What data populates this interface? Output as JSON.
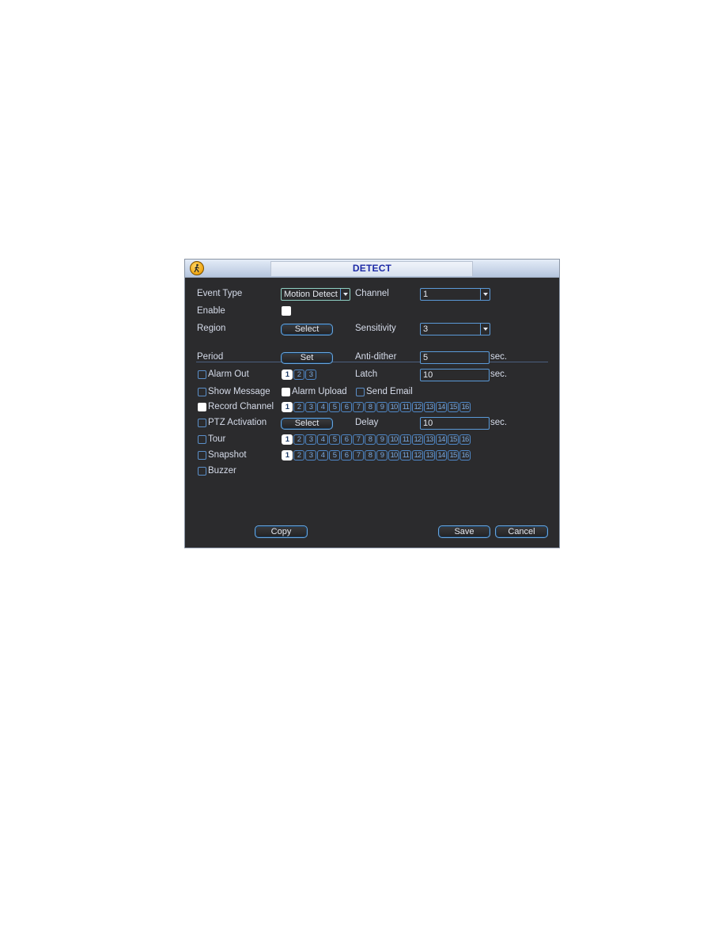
{
  "window": {
    "title": "DETECT",
    "icon": "motion-detect-person-icon"
  },
  "form": {
    "event_type": {
      "label": "Event Type",
      "value": "Motion Detect"
    },
    "channel": {
      "label": "Channel",
      "value": "1"
    },
    "enable": {
      "label": "Enable",
      "checked": true
    },
    "region": {
      "label": "Region",
      "button": "Select"
    },
    "sensitivity": {
      "label": "Sensitivity",
      "value": "3"
    },
    "period": {
      "label": "Period",
      "button": "Set"
    },
    "anti_dither": {
      "label": "Anti-dither",
      "value": "5",
      "unit": "sec."
    },
    "alarm_out": {
      "label": "Alarm Out",
      "checked": false,
      "channels": [
        "1",
        "2",
        "3"
      ],
      "selected": [
        "1"
      ]
    },
    "latch": {
      "label": "Latch",
      "value": "10",
      "unit": "sec."
    },
    "show_message": {
      "label": "Show Message",
      "checked": false
    },
    "alarm_upload": {
      "label": "Alarm Upload",
      "checked": true
    },
    "send_email": {
      "label": "Send Email",
      "checked": false
    },
    "record_channel": {
      "label": "Record Channel",
      "checked": true,
      "channels": [
        "1",
        "2",
        "3",
        "4",
        "5",
        "6",
        "7",
        "8",
        "9",
        "10",
        "11",
        "12",
        "13",
        "14",
        "15",
        "16"
      ],
      "selected": [
        "1"
      ]
    },
    "ptz_activation": {
      "label": "PTZ Activation",
      "checked": false,
      "button": "Select"
    },
    "delay": {
      "label": "Delay",
      "value": "10",
      "unit": "sec."
    },
    "tour": {
      "label": "Tour",
      "checked": false,
      "channels": [
        "1",
        "2",
        "3",
        "4",
        "5",
        "6",
        "7",
        "8",
        "9",
        "10",
        "11",
        "12",
        "13",
        "14",
        "15",
        "16"
      ],
      "selected": [
        "1"
      ]
    },
    "snapshot": {
      "label": "Snapshot",
      "checked": false,
      "channels": [
        "1",
        "2",
        "3",
        "4",
        "5",
        "6",
        "7",
        "8",
        "9",
        "10",
        "11",
        "12",
        "13",
        "14",
        "15",
        "16"
      ],
      "selected": [
        "1"
      ]
    },
    "buzzer": {
      "label": "Buzzer",
      "checked": false
    }
  },
  "footer": {
    "copy": "Copy",
    "save": "Save",
    "cancel": "Cancel"
  },
  "colors": {
    "title_text": "#1d2aa6",
    "panel_bg": "#2b2b2d",
    "accent_border": "#5b9ad8"
  }
}
